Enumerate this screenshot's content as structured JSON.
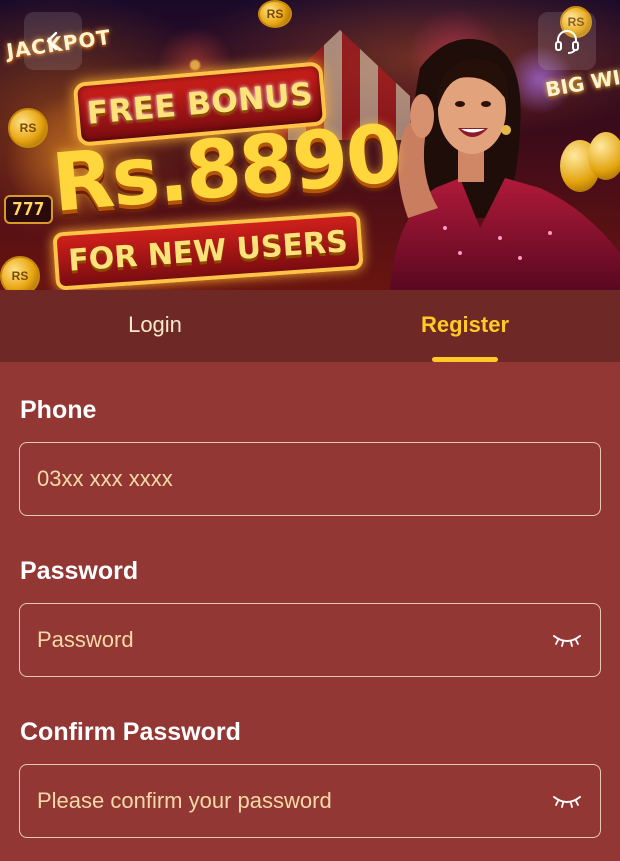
{
  "banner": {
    "jackpot_text": "JACKPOT",
    "big_win_text": "BIG WIN",
    "free_bonus_text": "FREE BONUS",
    "amount_text": "Rs.8890",
    "for_new_users_text": "FOR NEW USERS",
    "coin_text": "RS",
    "slot_text": "777",
    "back_icon": "chevron-left-icon",
    "support_icon": "headset-icon"
  },
  "tabs": {
    "items": [
      {
        "label": "Login",
        "active": false
      },
      {
        "label": "Register",
        "active": true
      }
    ],
    "active_color": "#ffc928"
  },
  "form": {
    "phone": {
      "label": "Phone",
      "placeholder": "03xx xxx xxxx"
    },
    "password": {
      "label": "Password",
      "placeholder": "Password",
      "toggle_icon": "eye-closed-icon"
    },
    "confirm_password": {
      "label": "Confirm Password",
      "placeholder": "Please confirm your password",
      "toggle_icon": "eye-closed-icon"
    }
  },
  "colors": {
    "background": "#933735",
    "tab_bar": "#6e2825",
    "accent": "#ffc928",
    "placeholder": "#f4d9a6"
  }
}
